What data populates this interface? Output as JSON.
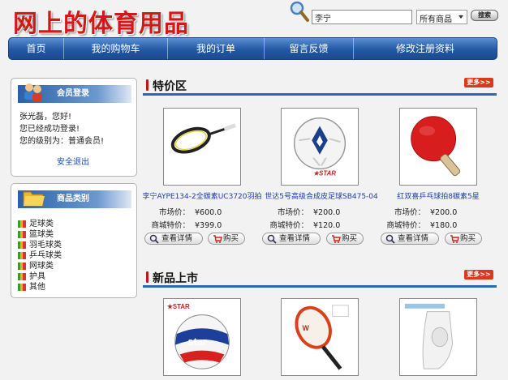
{
  "logo": "网上的体育用品",
  "search": {
    "value": "李宁",
    "category": "所有商品",
    "button": "搜索"
  },
  "nav": [
    "首页",
    "我的购物车",
    "我的订单",
    "留言反馈",
    "修改注册资料"
  ],
  "login": {
    "title": "会员登录",
    "lines": [
      "张光磊，您好!",
      "您已经成功登录!",
      "您的级别为：普通会员!"
    ],
    "logout": "安全退出"
  },
  "categories": {
    "title": "商品类别",
    "items": [
      "足球类",
      "篮球类",
      "羽毛球类",
      "乒乓球类",
      "网球类",
      "护具",
      "其他"
    ]
  },
  "special": {
    "title": "特价区",
    "more": "更多>>",
    "price_label": "市场价：",
    "sale_label": "商城特价：",
    "detail_btn": "查看详情",
    "buy_btn": "购买",
    "items": [
      {
        "name": "李宁AYPE134-2全碳素UC3720羽拍",
        "market": "¥600.0",
        "sale": "¥399.0"
      },
      {
        "name": "世达5号高级合成皮足球SB475-04",
        "market": "¥200.0",
        "sale": "¥120.0"
      },
      {
        "name": "红双喜乒乓球拍8碳素5星",
        "market": "¥200.0",
        "sale": "¥180.0"
      }
    ]
  },
  "new_arrivals": {
    "title": "新品上市",
    "more": "更多>>"
  }
}
